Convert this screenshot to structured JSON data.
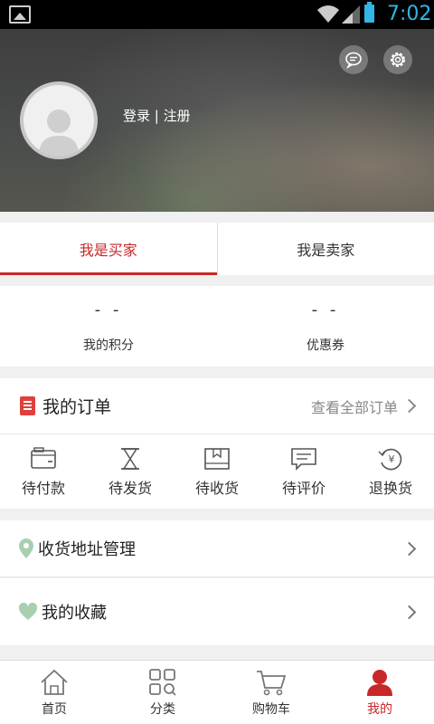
{
  "status_bar": {
    "time": "7:02",
    "icons": [
      "image-icon",
      "wifi-icon",
      "signal-icon",
      "battery-icon"
    ],
    "accent_color": "#33b5e5"
  },
  "header": {
    "login_text": "登录 | 注册",
    "icons": [
      "message-icon",
      "settings-icon",
      "avatar-icon"
    ]
  },
  "tabs": {
    "buyer": "我是买家",
    "seller": "我是卖家",
    "active": "buyer",
    "active_color": "#c82828"
  },
  "points": {
    "points_value": "- -",
    "points_label": "我的积分",
    "coupon_value": "- -",
    "coupon_label": "优惠券"
  },
  "orders": {
    "title": "我的订单",
    "view_all": "查看全部订单",
    "items": [
      {
        "label": "待付款",
        "icon": "wallet-icon"
      },
      {
        "label": "待发货",
        "icon": "hourglass-icon"
      },
      {
        "label": "待收货",
        "icon": "box-icon"
      },
      {
        "label": "待评价",
        "icon": "comment-icon"
      },
      {
        "label": "退换货",
        "icon": "refund-icon"
      }
    ]
  },
  "rows": {
    "address": "收货地址管理",
    "favorites": "我的收藏"
  },
  "nav": {
    "items": [
      {
        "label": "首页",
        "icon": "home-icon"
      },
      {
        "label": "分类",
        "icon": "category-icon"
      },
      {
        "label": "购物车",
        "icon": "cart-icon"
      },
      {
        "label": "我的",
        "icon": "user-icon"
      }
    ],
    "active_index": 3
  }
}
